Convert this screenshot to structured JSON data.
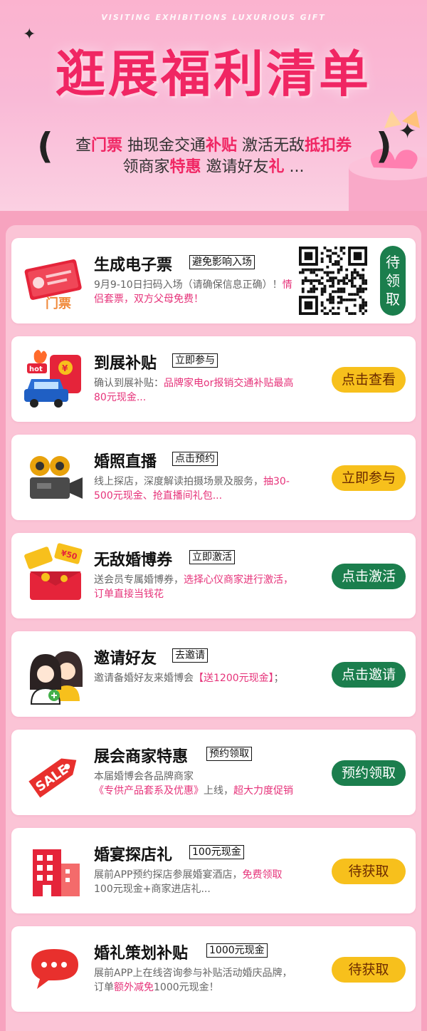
{
  "header": {
    "subtitle": "VISITING EXHIBITIONS LUXURIOUS GIFT",
    "title": "逛展福利清单",
    "line1": [
      {
        "text": "查",
        "hl": false
      },
      {
        "text": "门票",
        "hl": true
      },
      {
        "text": "  抽现金交通",
        "hl": false
      },
      {
        "text": "补贴",
        "hl": true
      },
      {
        "text": "  激活无敌",
        "hl": false
      },
      {
        "text": "抵扣券",
        "hl": true
      }
    ],
    "line2": [
      {
        "text": "领商家",
        "hl": false
      },
      {
        "text": "特惠",
        "hl": true
      },
      {
        "text": "  邀请好友",
        "hl": false
      },
      {
        "text": "礼",
        "hl": true
      },
      {
        "text": " ...",
        "hl": false
      }
    ]
  },
  "cards": [
    {
      "title": "生成电子票",
      "tag": "避免影响入场",
      "desc_plain": "9月9-10日扫码入场（请确保信息正确）！",
      "desc_pink": "情侣套票，双方父母免费！",
      "button": "待领取",
      "icon": "ticket-icon"
    },
    {
      "title": "到展补贴",
      "tag": "立即参与",
      "desc_plain": "确认到展补贴：",
      "desc_pink": "品牌家电or报销交通补贴最高80元现金...",
      "button": "点击查看",
      "icon": "subsidy-car-icon"
    },
    {
      "title": "婚照直播",
      "tag": "点击预约",
      "desc_plain": "线上探店，深度解读拍摄场景及服务，",
      "desc_pink": "抽30-500元现金、抢直播间礼包...",
      "button": "立即参与",
      "icon": "video-camera-icon"
    },
    {
      "title": "无敌婚博券",
      "tag": "立即激活",
      "desc_plain": "送会员专属婚博券，",
      "desc_pink": "选择心仪商家进行激活，订单直接当钱花",
      "button": "点击激活",
      "icon": "coupon-gift-icon"
    },
    {
      "title": "邀请好友",
      "tag": "去邀请",
      "desc_plain": "邀请备婚好友来婚博会",
      "desc_pink": "【送1200元现金】",
      "desc_tail": "；",
      "button": "点击邀请",
      "icon": "invite-friends-icon"
    },
    {
      "title": "展会商家特惠",
      "tag": "预约领取",
      "desc_plain": "本届婚博会各品牌商家",
      "desc_pink": "《专供产品套系及优惠》",
      "desc_tail": "上线，",
      "desc_pink2": "超大力度促销",
      "button": "预约领取",
      "icon": "sale-tag-icon"
    },
    {
      "title": "婚宴探店礼",
      "tag": "100元现金",
      "desc_plain": "展前APP预约探店参展婚宴酒店，",
      "desc_pink": "免费领取",
      "desc_tail": "100元现金+商家进店礼...",
      "button": "待获取",
      "icon": "hotel-building-icon"
    },
    {
      "title": "婚礼策划补贴",
      "tag": "1000元现金",
      "desc_plain": "展前APP上在线咨询参与补贴活动婚庆品牌，订单",
      "desc_pink": "额外减免",
      "desc_tail": "1000元现金！",
      "button": "待获取",
      "icon": "chat-bubble-icon"
    }
  ],
  "colors": {
    "accent": "#f02663",
    "pink_text": "#e6337a",
    "green_button": "#1b7e4d",
    "yellow_button": "#f7c01c"
  }
}
